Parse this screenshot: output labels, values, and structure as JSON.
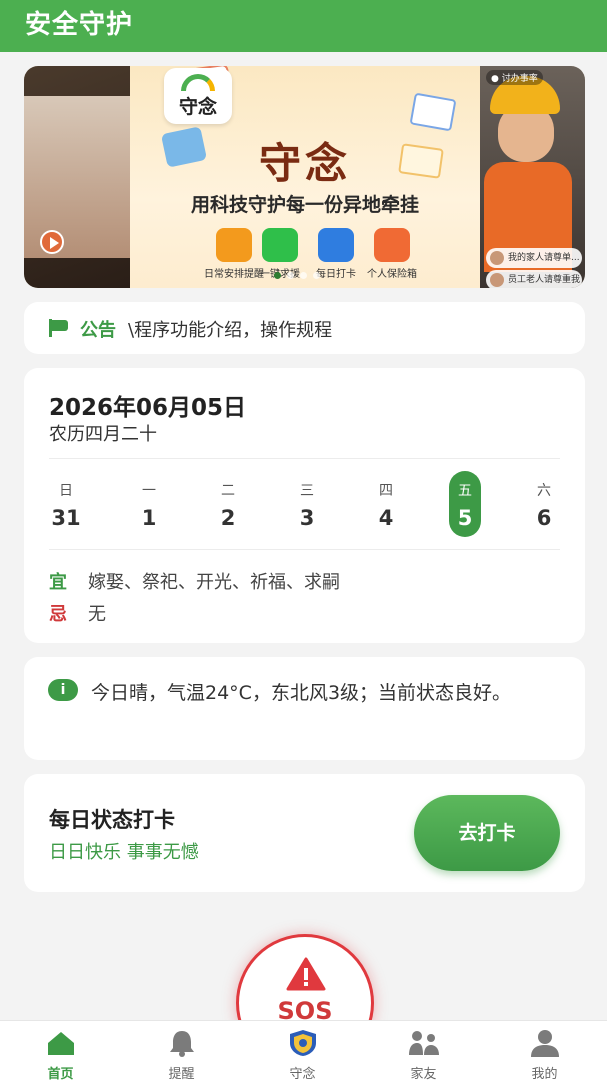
{
  "header": {
    "title": "安全守护"
  },
  "banner": {
    "logo_text": "守念",
    "brand": "守念",
    "slogan": "用科技守护每一份异地牵挂",
    "features": [
      {
        "label": "日常安排提醒",
        "color": "#f39a1d"
      },
      {
        "label": "一键求援",
        "color": "#2fbf4a"
      },
      {
        "label": "每日打卡",
        "color": "#2f7de0"
      },
      {
        "label": "个人保险箱",
        "color": "#f06a34"
      }
    ],
    "right_tag": "● 讨办事率",
    "chips": [
      "我的家人请尊单...",
      "员工老人请尊重我"
    ]
  },
  "notice": {
    "label": "公告",
    "text": "\\程序功能介绍，操作规程"
  },
  "calendar": {
    "date": "2026年06月05日",
    "lunar": "农历四月二十",
    "week": [
      {
        "name": "日",
        "day": "31"
      },
      {
        "name": "一",
        "day": "1"
      },
      {
        "name": "二",
        "day": "2"
      },
      {
        "name": "三",
        "day": "3"
      },
      {
        "name": "四",
        "day": "4"
      },
      {
        "name": "五",
        "day": "5"
      },
      {
        "name": "六",
        "day": "6"
      }
    ],
    "selected_index": 5,
    "yi_label": "宜",
    "yi_value": "嫁娶、祭祀、开光、祈福、求嗣",
    "ji_label": "忌",
    "ji_value": "无"
  },
  "weather": {
    "icon": "info-icon",
    "text": "今日晴，气温24°C，东北风3级；当前状态良好。"
  },
  "checkin": {
    "title": "每日状态打卡",
    "subtitle": "日日快乐 事事无憾",
    "button": "去打卡"
  },
  "sos": {
    "label": "SOS"
  },
  "tabbar": {
    "items": [
      {
        "label": "首页",
        "icon": "home-icon",
        "active": true
      },
      {
        "label": "提醒",
        "icon": "bell-icon",
        "active": false
      },
      {
        "label": "守念",
        "icon": "badge-icon",
        "active": false
      },
      {
        "label": "家友",
        "icon": "family-icon",
        "active": false
      },
      {
        "label": "我的",
        "icon": "user-icon",
        "active": false
      }
    ]
  },
  "colors": {
    "primary": "#4caf50",
    "accent_green": "#3d9a46",
    "danger": "#d0393a"
  }
}
